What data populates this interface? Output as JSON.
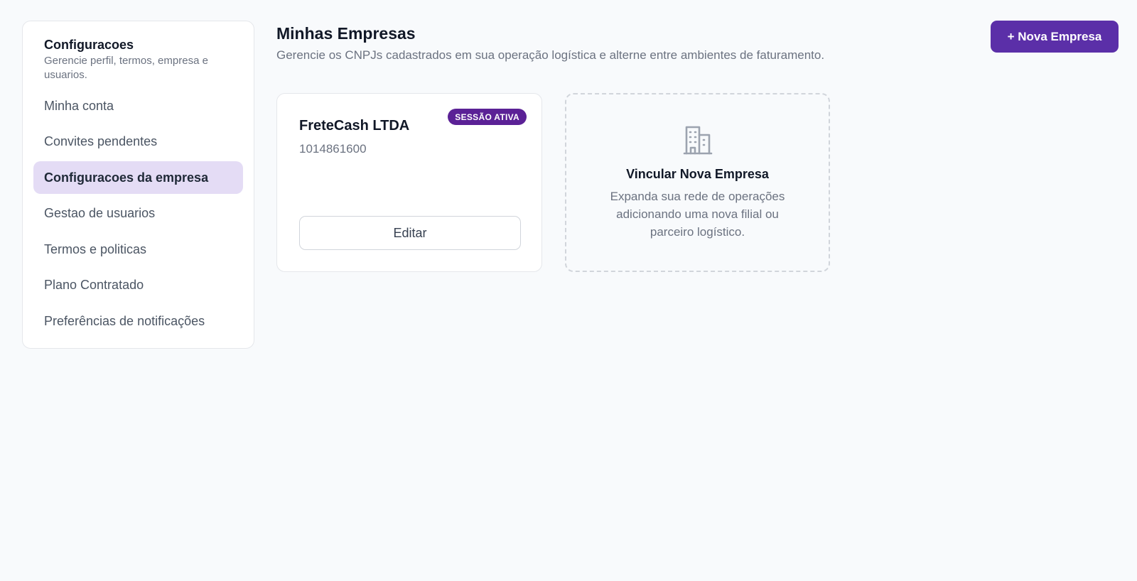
{
  "sidebar": {
    "title": "Configuracoes",
    "subtitle": "Gerencie perfil, termos, empresa e usuarios.",
    "items": [
      {
        "label": "Minha conta"
      },
      {
        "label": "Convites pendentes"
      },
      {
        "label": "Configuracoes da empresa",
        "active": true
      },
      {
        "label": "Gestao de usuarios"
      },
      {
        "label": "Termos e politicas"
      },
      {
        "label": "Plano Contratado"
      },
      {
        "label": "Preferências de notificações"
      }
    ]
  },
  "header": {
    "title": "Minhas Empresas",
    "subtitle": "Gerencie os CNPJs cadastrados em sua operação logística e alterne entre ambientes de faturamento.",
    "new_button_label": "+ Nova Empresa"
  },
  "company_card": {
    "badge": "SESSÃO ATIVA",
    "name": "FreteCash LTDA",
    "cnpj": "1014861600",
    "edit_label": "Editar"
  },
  "link_card": {
    "icon": "building-icon",
    "title": "Vincular Nova Empresa",
    "description": "Expanda sua rede de operações adicionando uma nova filial ou parceiro logístico."
  },
  "colors": {
    "accent": "#5b2fa8",
    "active_nav_bg": "#e4dcf5",
    "badge_bg": "#5b2196"
  }
}
